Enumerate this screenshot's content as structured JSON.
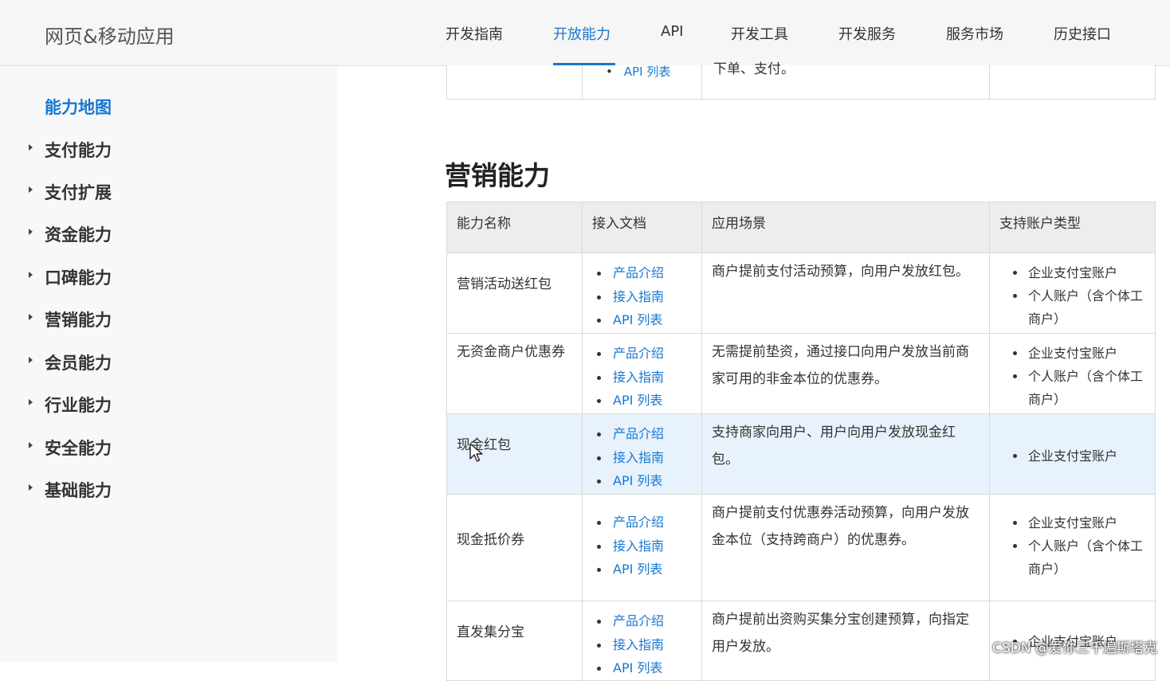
{
  "header": {
    "brand": "网页&移动应用",
    "nav": [
      "开发指南",
      "开放能力",
      "API",
      "开发工具",
      "开发服务",
      "服务市场",
      "历史接口"
    ],
    "active_index": 1
  },
  "sidebar": {
    "top": "能力地图",
    "items": [
      "支付能力",
      "支付扩展",
      "资金能力",
      "口碑能力",
      "营销能力",
      "会员能力",
      "行业能力",
      "安全能力",
      "基础能力"
    ]
  },
  "prev_table": {
    "doc_link": "API 列表",
    "scene_tail": "下单、支付。"
  },
  "section": {
    "title": "营销能力",
    "headers": [
      "能力名称",
      "接入文档",
      "应用场景",
      "支持账户类型"
    ],
    "rows": [
      {
        "name": "营销活动送红包",
        "docs": [
          "产品介绍",
          "接入指南",
          "API 列表"
        ],
        "scene": "商户提前支付活动预算，向用户发放红包。",
        "accounts": [
          "企业支付宝账户",
          "个人账户（含个体工商户）"
        ]
      },
      {
        "name": "无资金商户优惠券",
        "docs": [
          "产品介绍",
          "接入指南",
          "API 列表"
        ],
        "scene": "无需提前垫资，通过接口向用户发放当前商家可用的非金本位的优惠券。",
        "accounts": [
          "企业支付宝账户",
          "个人账户（含个体工商户）"
        ]
      },
      {
        "name": "现金红包",
        "docs": [
          "产品介绍",
          "接入指南",
          "API 列表"
        ],
        "scene": "支持商家向用户、用户向用户发放现金红包。",
        "accounts": [
          "企业支付宝账户"
        ]
      },
      {
        "name": "现金抵价券",
        "docs": [
          "产品介绍",
          "接入指南",
          "API 列表"
        ],
        "scene": "商户提前支付优惠券活动预算，向用户发放金本位（支持跨商户）的优惠券。",
        "accounts": [
          "企业支付宝账户",
          "个人账户（含个体工商户）"
        ]
      },
      {
        "name": "直发集分宝",
        "docs": [
          "产品介绍",
          "接入指南",
          "API 列表"
        ],
        "scene": "商户提前出资购买集分宝创建预算，向指定用户发放。",
        "accounts": [
          "企业支付宝账户"
        ]
      }
    ]
  },
  "watermark": "CSDN @爱你三千遍斯塔克",
  "colors": {
    "link": "#1677d2",
    "highlight_row": "#e8f2fc",
    "header_bg": "#f6f6f6"
  }
}
